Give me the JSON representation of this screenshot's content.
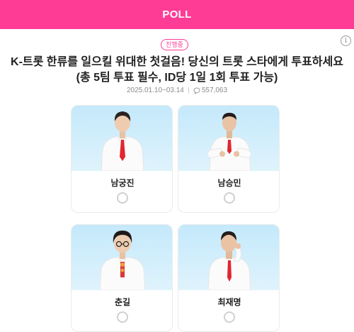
{
  "header": {
    "title": "POLL"
  },
  "info_icon": {
    "glyph": "i",
    "icon": "info-icon"
  },
  "poll": {
    "status": "진행중",
    "title": "K-트롯 한류를 일으킬 위대한 첫걸음! 당신의 트롯 스타에게 투표하세요 (총 5팀 투표 필수, ID당 1일 1회 투표 가능)",
    "period": "2025.01.10~03.14",
    "comment_count": "557,063"
  },
  "candidates": [
    {
      "name": "남궁진"
    },
    {
      "name": "남승민"
    },
    {
      "name": "춘길"
    },
    {
      "name": "최재명"
    }
  ],
  "colors": {
    "accent": "#fe3c96",
    "card_bg": "#c4e9fb",
    "suit": "#ffffff",
    "tie": "#e1262f"
  }
}
